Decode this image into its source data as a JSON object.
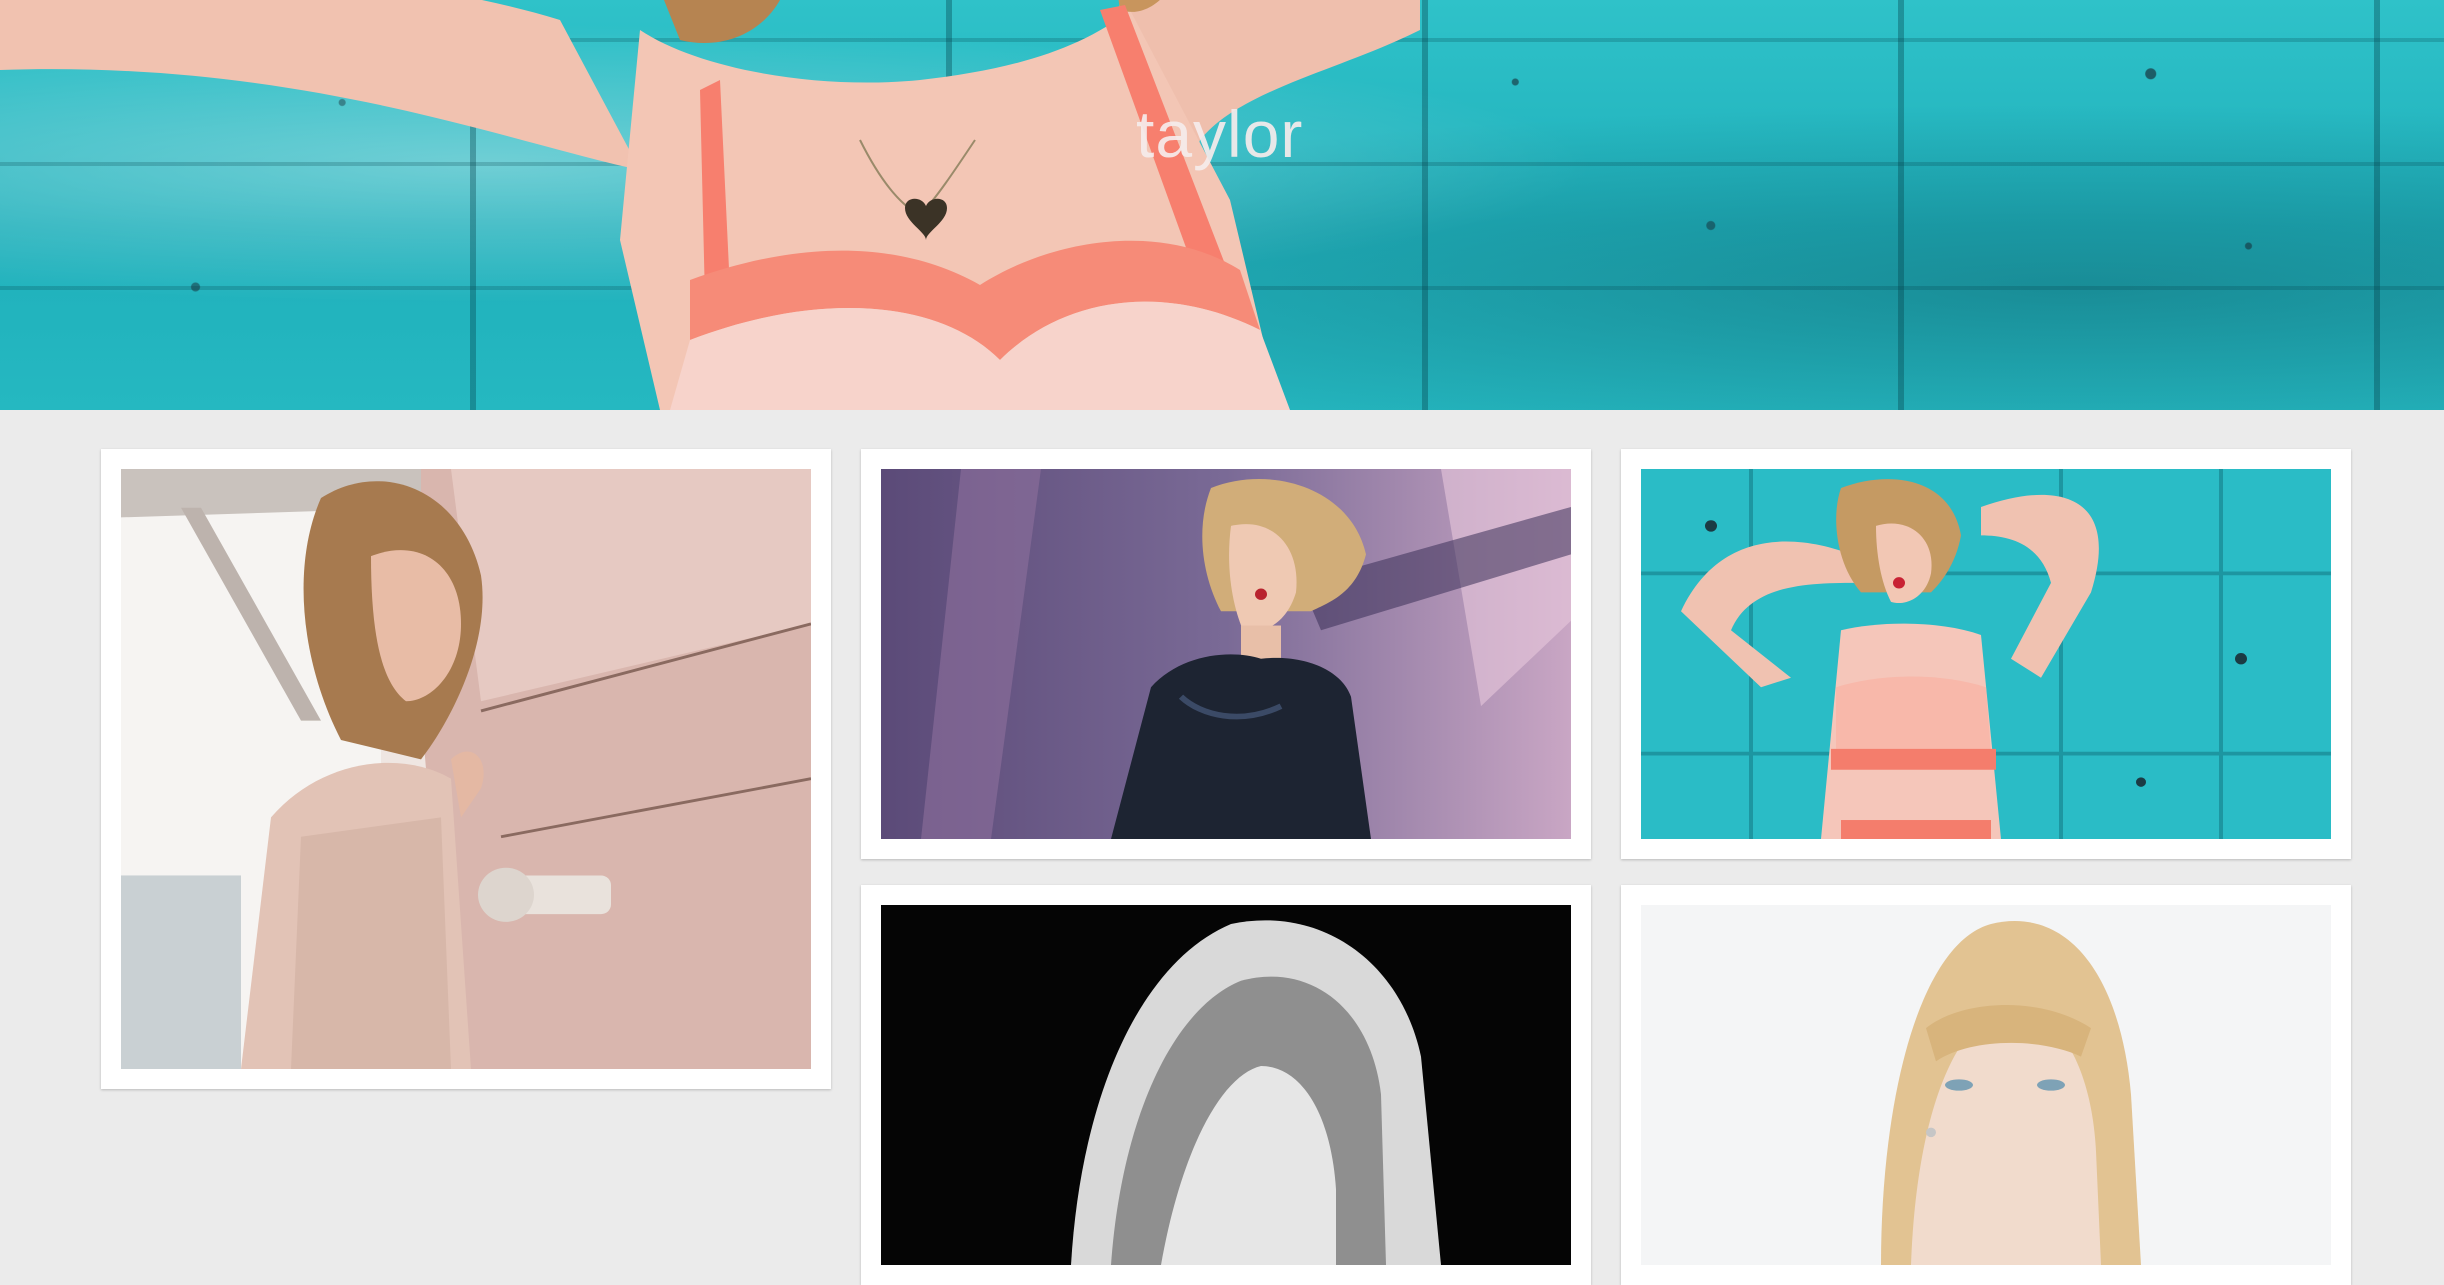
{
  "page": {
    "title": "taylor"
  },
  "gallery": {
    "photos": [
      {
        "name": "photo-wet-wall",
        "description_icon": "photo-icon"
      },
      {
        "name": "photo-stage-sequin",
        "description_icon": "photo-icon"
      },
      {
        "name": "photo-teal-wall",
        "description_icon": "photo-icon"
      },
      {
        "name": "photo-black-white",
        "description_icon": "photo-icon"
      },
      {
        "name": "photo-white-portrait",
        "description_icon": "photo-icon"
      }
    ]
  },
  "colors": {
    "background": "#ebebeb",
    "teal": "#2fc2c9",
    "title": "#f6ecec",
    "card": "#ffffff"
  }
}
